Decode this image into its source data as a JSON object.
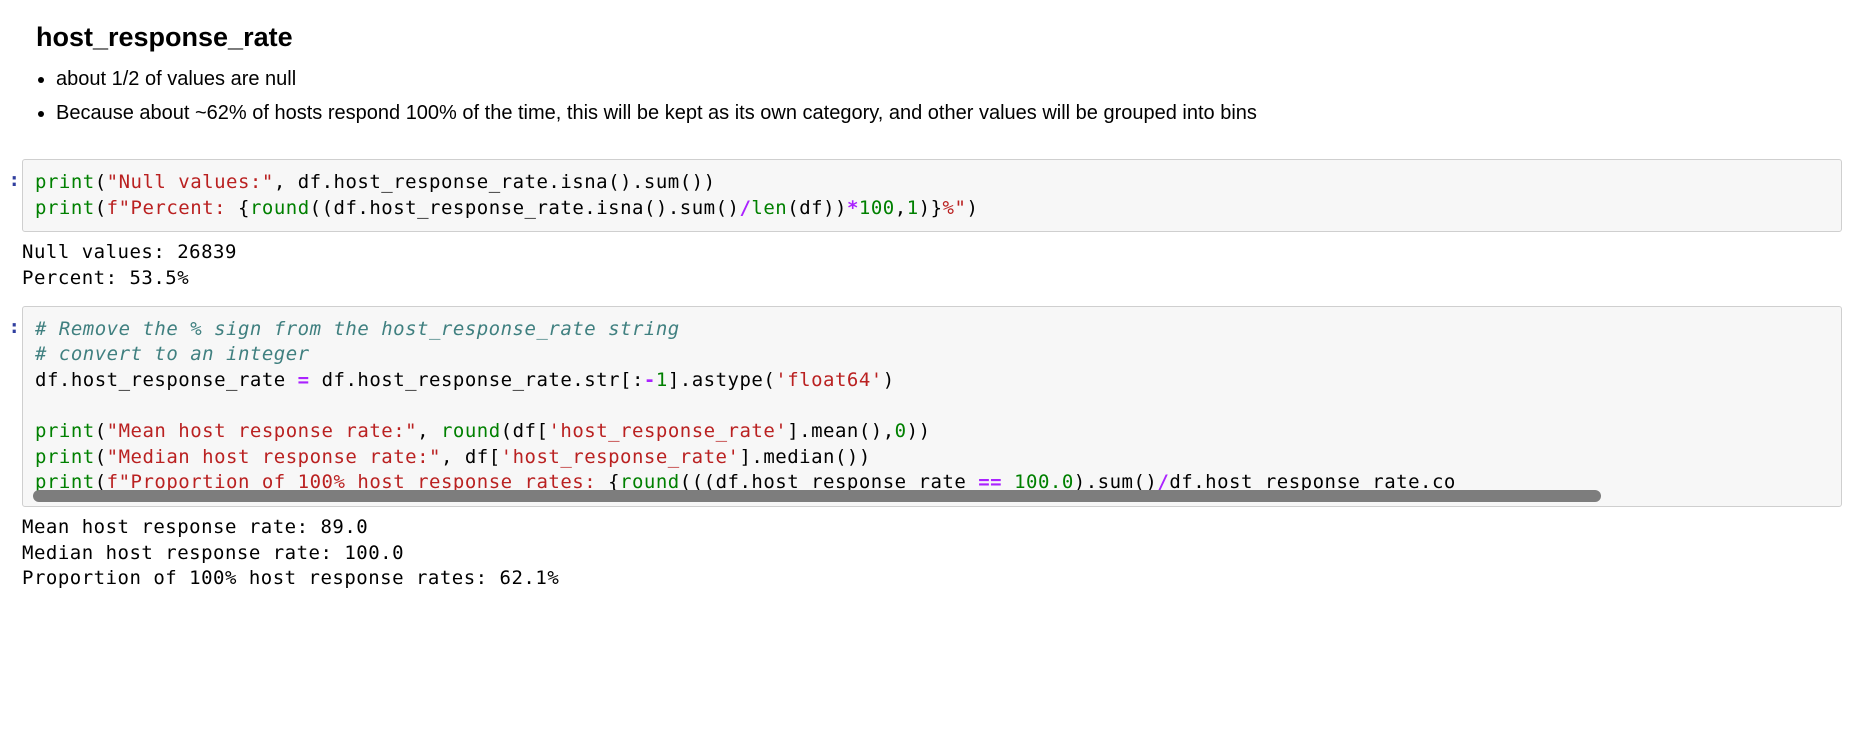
{
  "heading": "host_response_rate",
  "bullets": [
    "about 1/2 of values are null",
    "Because about ~62% of hosts respond 100% of the time, this will be kept as its own category, and other values will be grouped into bins"
  ],
  "prompt1": ":",
  "code1": {
    "l1_print": "print",
    "l1_open": "(",
    "l1_str": "\"Null values:\"",
    "l1_rest": ", df.host_response_rate.isna().sum())",
    "l2_print": "print",
    "l2_open": "(",
    "l2_fpre": "f\"Percent: ",
    "l2_brace_open": "{",
    "l2_round": "round",
    "l2_mid1": "((df.host_response_rate.isna().sum()",
    "l2_div": "/",
    "l2_len": "len",
    "l2_mid2": "(df))",
    "l2_star": "*",
    "l2_num1": "100",
    "l2_comma": ",",
    "l2_num2": "1",
    "l2_close1": ")",
    "l2_brace_close": "}",
    "l2_fsuf": "%\"",
    "l2_close2": ")"
  },
  "output1": "Null values: 26839\nPercent: 53.5%",
  "prompt2": ":",
  "code2": {
    "c1": "# Remove the % sign from the host_response_rate string",
    "c2": "# convert to an integer",
    "l3_a": "df.host_response_rate ",
    "l3_eq": "=",
    "l3_b": " df.host_response_rate.str[:",
    "l3_neg": "-",
    "l3_one": "1",
    "l3_c": "].astype(",
    "l3_str": "'float64'",
    "l3_d": ")",
    "l5_print": "print",
    "l5_open": "(",
    "l5_str": "\"Mean host response rate:\"",
    "l5_comma": ", ",
    "l5_round": "round",
    "l5_mid": "(df[",
    "l5_col": "'host_response_rate'",
    "l5_rest": "].mean(),",
    "l5_zero": "0",
    "l5_close": "))",
    "l6_print": "print",
    "l6_open": "(",
    "l6_str": "\"Median host response rate:\"",
    "l6_comma": ", df[",
    "l6_col": "'host_response_rate'",
    "l6_rest": "].median())",
    "l7_print": "print",
    "l7_open": "(",
    "l7_fpre": "f\"Proportion of 100% host response rates: ",
    "l7_brace_open": "{",
    "l7_round": "round",
    "l7_a": "(((df.host_response_rate ",
    "l7_eq": "==",
    "l7_b": " ",
    "l7_num": "100.0",
    "l7_c": ").sum()",
    "l7_div": "/",
    "l7_d": "df.host_response_rate.co"
  },
  "output2": "Mean host response rate: 89.0\nMedian host response rate: 100.0\nProportion of 100% host response rates: 62.1%"
}
